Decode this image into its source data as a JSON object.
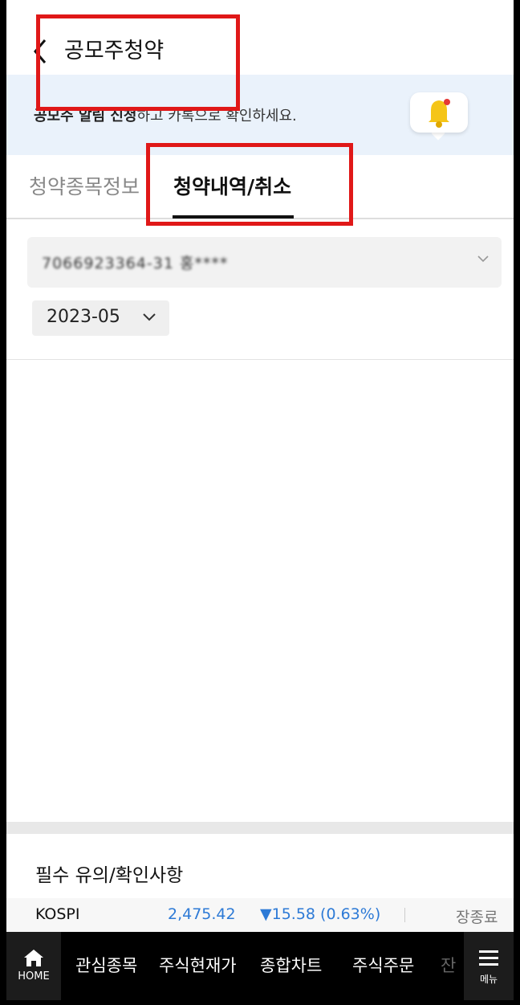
{
  "header": {
    "title": "공모주청약"
  },
  "banner": {
    "bold_text": "공모주 알림 신청",
    "text": "하고 카톡으로 확인하세요."
  },
  "tabs": [
    {
      "label": "청약종목정보",
      "active": false
    },
    {
      "label": "청약내역/취소",
      "active": true
    }
  ],
  "account": {
    "value": "7066923364-31 홍****"
  },
  "month": {
    "value": "2023-05"
  },
  "notice": {
    "title": "필수 유의/확인사항"
  },
  "ticker": {
    "name": "KOSPI",
    "value": "2,475.42",
    "change": "▼15.58 (0.63%)",
    "status": "장종료"
  },
  "bottom_nav": {
    "home_label": "HOME",
    "items": [
      "관심종목",
      "주식현재가",
      "종합차트",
      "주식주문",
      "잔"
    ],
    "menu_label": "메뉴"
  },
  "colors": {
    "accent": "#2d7ad6",
    "annotation": "#e01818",
    "banner_bg": "#eaf2fb"
  }
}
